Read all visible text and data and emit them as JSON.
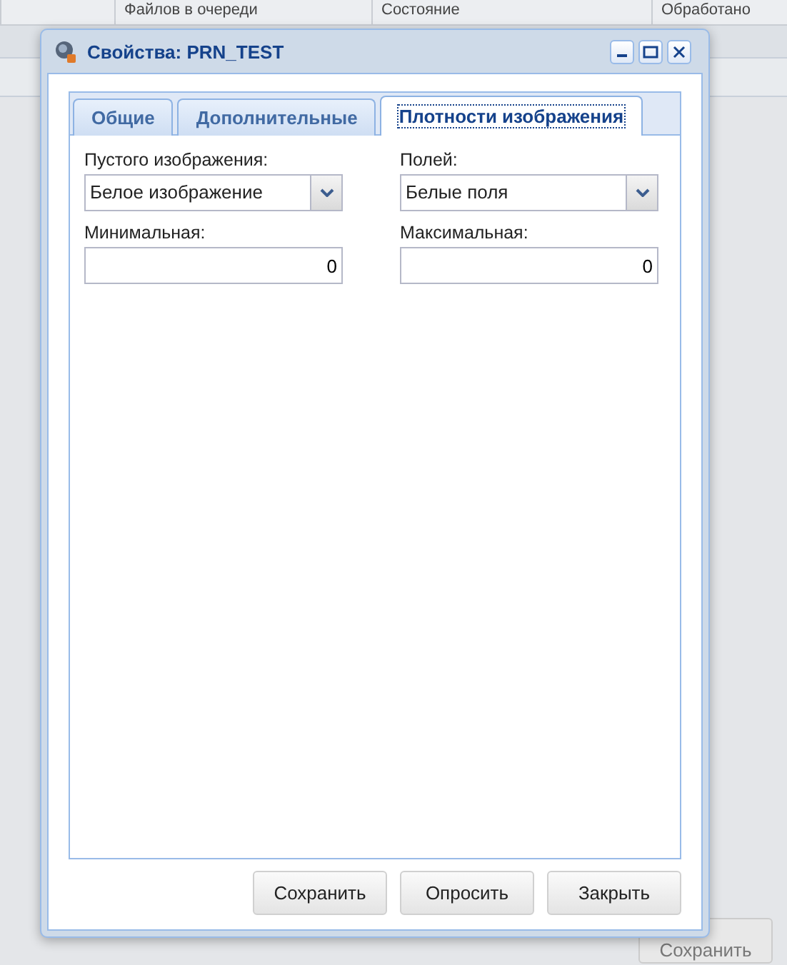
{
  "background": {
    "columns": [
      "Файлов в очереди",
      "Состояние",
      "Обработано"
    ],
    "button": {
      "label": "Сохранить",
      "disabled": true
    }
  },
  "window": {
    "title": "Свойства: PRN_TEST"
  },
  "tabs": [
    {
      "label": "Общие",
      "selected": false
    },
    {
      "label": "Дополнительные",
      "selected": false
    },
    {
      "label": "Плотности изображения",
      "selected": true
    }
  ],
  "fields": [
    {
      "kind": "select",
      "label": "Пустого изображения:",
      "value": "Белое изображение"
    },
    {
      "kind": "select",
      "label": "Полей:",
      "value": "Белые поля"
    },
    {
      "kind": "number",
      "label": "Минимальная:",
      "value": "0"
    },
    {
      "kind": "number",
      "label": "Максимальная:",
      "value": "0"
    }
  ],
  "buttons": [
    "Сохранить",
    "Опросить",
    "Закрыть"
  ]
}
